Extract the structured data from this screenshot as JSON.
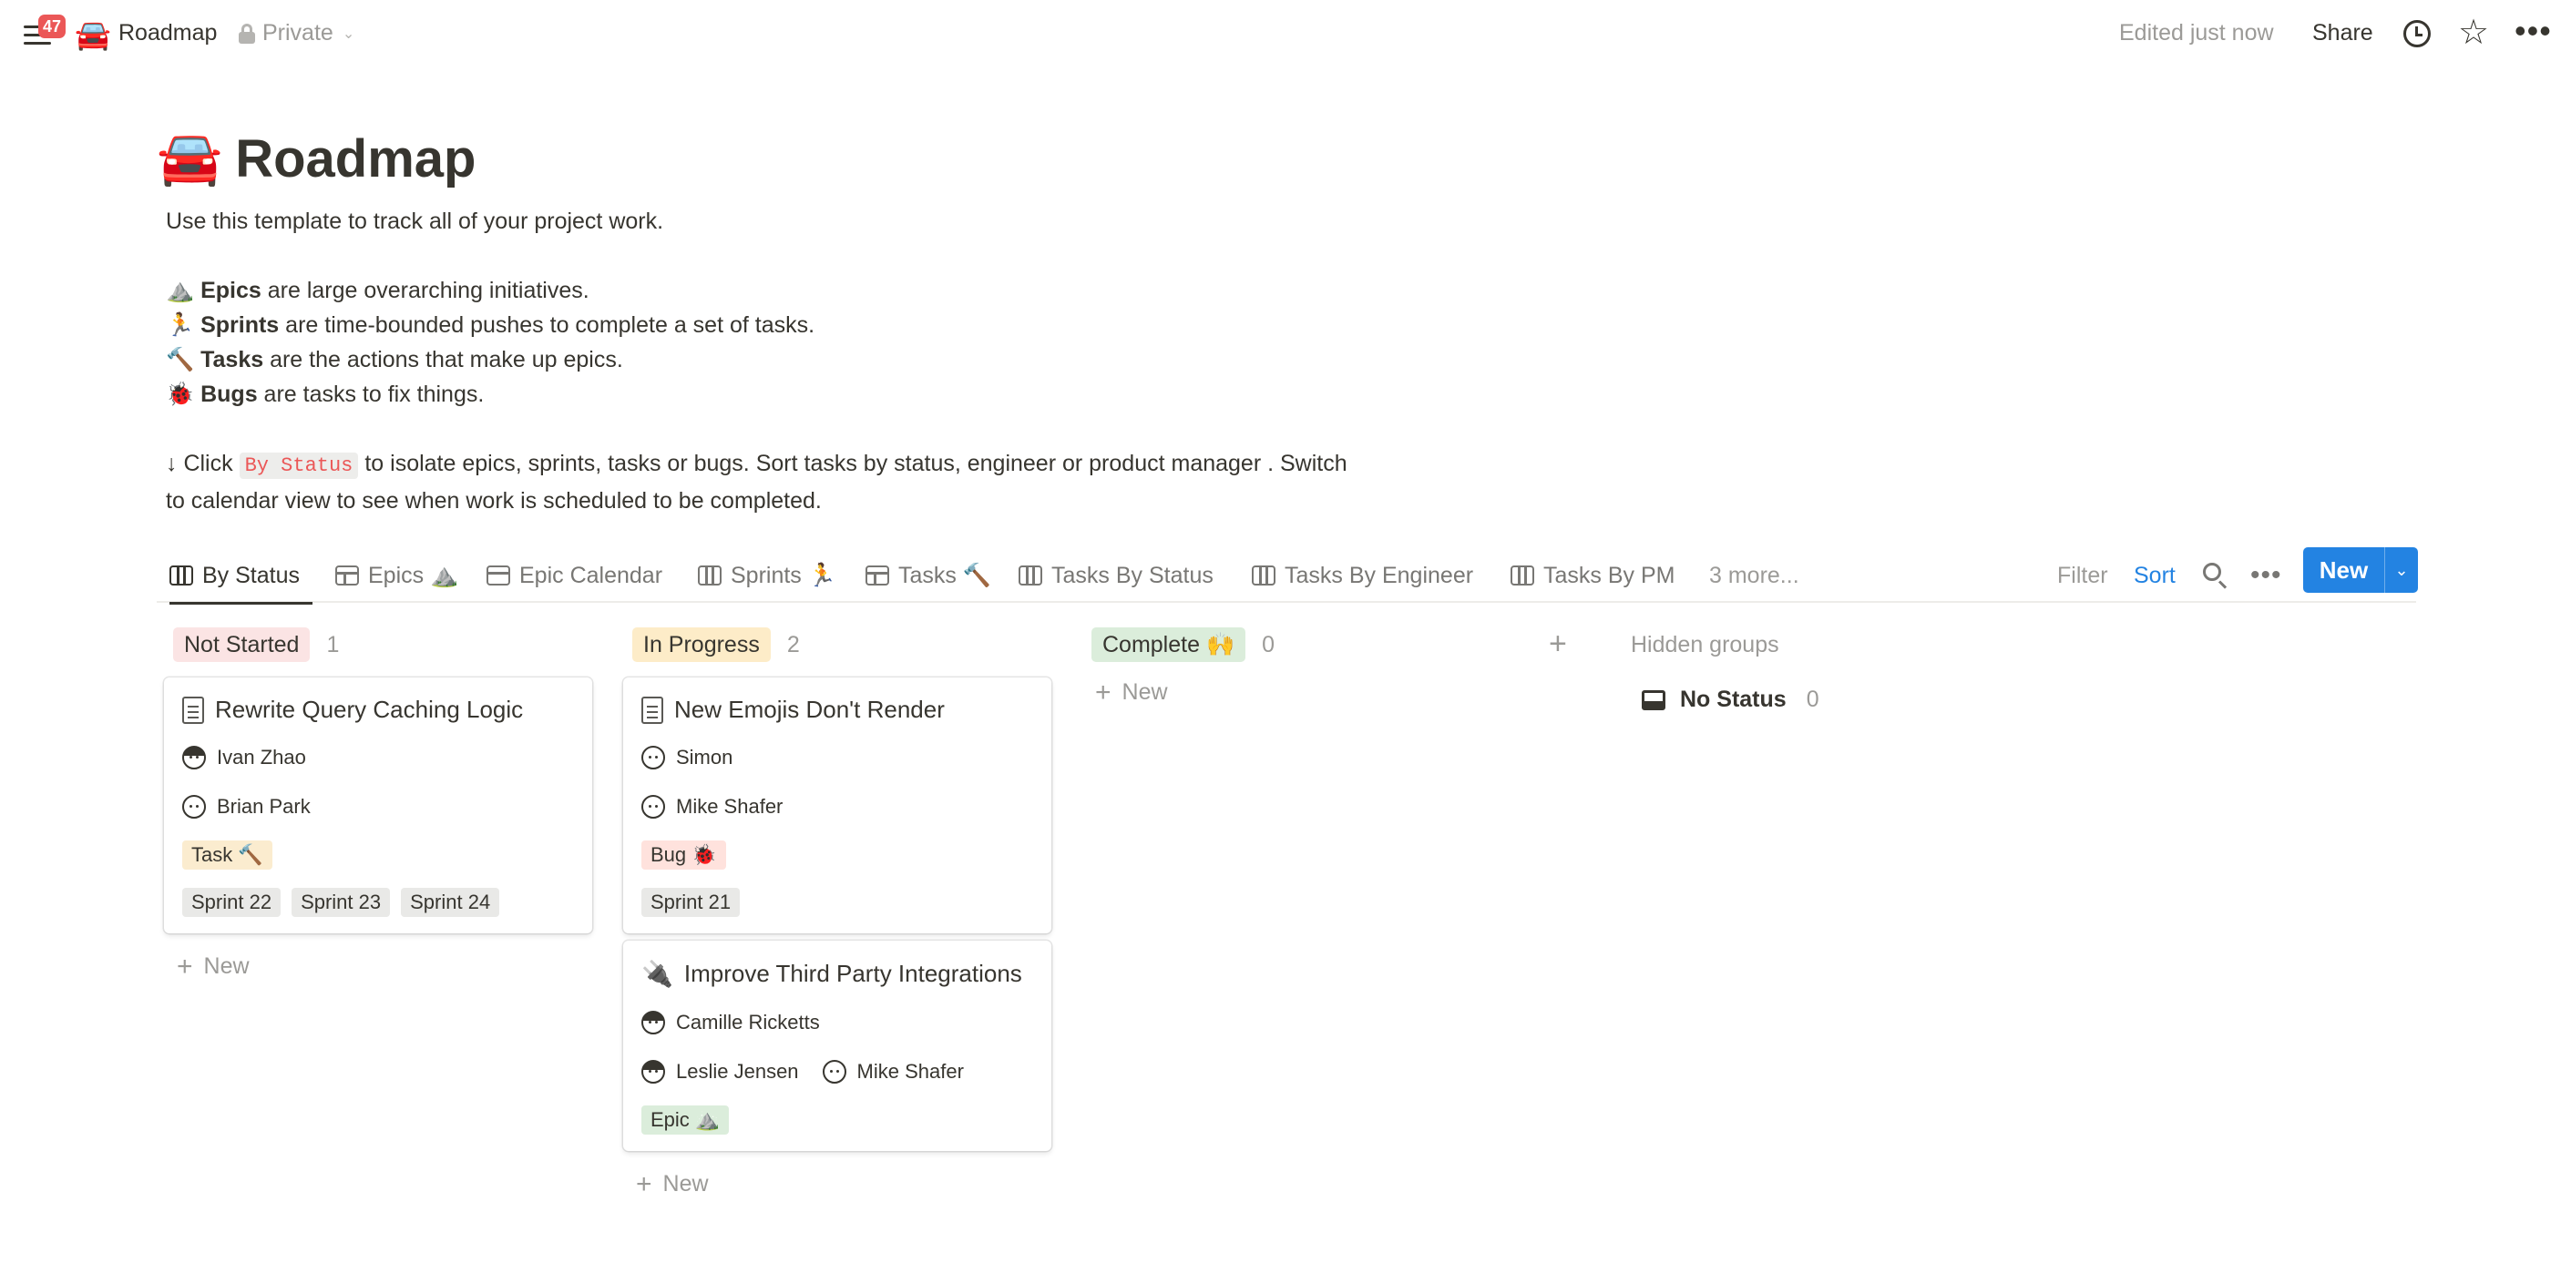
{
  "topbar": {
    "notification_count": "47",
    "page_icon": "🚘",
    "page_name": "Roadmap",
    "privacy": "Private",
    "edited": "Edited just now",
    "share_label": "Share",
    "icons": [
      "menu-icon",
      "lock-icon",
      "chevron-down-icon",
      "clock-icon",
      "star-icon",
      "more-icon"
    ]
  },
  "page": {
    "icon": "🚘",
    "title": "Roadmap",
    "intro": "Use this template to track all of your project work.",
    "lines": [
      {
        "emoji": "⛰️",
        "bold": "Epics",
        "text": " are large overarching initiatives."
      },
      {
        "emoji": "🏃",
        "bold": "Sprints",
        "text": " are time-bounded pushes to complete a set of tasks."
      },
      {
        "emoji": "🔨",
        "bold": "Tasks",
        "text": " are the actions that make up epics."
      },
      {
        "emoji": "🐞",
        "bold": "Bugs",
        "text": " are tasks to fix things."
      }
    ],
    "click_prefix": "↓ Click",
    "click_code": "By Status",
    "click_suffix": "to isolate epics, sprints, tasks or bugs. Sort tasks by status, engineer or product manager . Switch",
    "click_line2": "to calendar view to see when work is scheduled to be completed."
  },
  "views": {
    "tabs": [
      {
        "label": "By Status",
        "icon": "board-view-icon",
        "active": true
      },
      {
        "label": "Epics ⛰️",
        "icon": "table-view-icon",
        "active": false
      },
      {
        "label": "Epic Calendar",
        "icon": "calendar-view-icon",
        "active": false
      },
      {
        "label": "Sprints 🏃",
        "icon": "board-view-icon",
        "active": false
      },
      {
        "label": "Tasks 🔨",
        "icon": "table-view-icon",
        "active": false
      },
      {
        "label": "Tasks By Status",
        "icon": "board-view-icon",
        "active": false
      },
      {
        "label": "Tasks By Engineer",
        "icon": "board-view-icon",
        "active": false
      },
      {
        "label": "Tasks By PM",
        "icon": "board-view-icon",
        "active": false
      }
    ],
    "more": "3 more...",
    "filter": "Filter",
    "sort": "Sort",
    "new_label": "New",
    "accent_color": "#2383e2"
  },
  "board": {
    "columns": [
      {
        "status": "Not Started",
        "count": "1",
        "tag_bg": "#fbe4e4",
        "cards": [
          {
            "icon": "page",
            "title": "Rewrite Query Caching Logic",
            "people_rows": [
              [
                "Ivan Zhao"
              ],
              [
                "Brian Park"
              ]
            ],
            "type_tag": "Task 🔨",
            "type_bg": "#fbeccf",
            "sprints": [
              "Sprint 22",
              "Sprint 23",
              "Sprint 24"
            ]
          }
        ],
        "add_label": "New"
      },
      {
        "status": "In Progress",
        "count": "2",
        "tag_bg": "#fdecc8",
        "cards": [
          {
            "icon": "page",
            "title": "New Emojis Don't Render",
            "people_rows": [
              [
                "Simon"
              ],
              [
                "Mike Shafer"
              ]
            ],
            "type_tag": "Bug 🐞",
            "type_bg": "#ffe2dd",
            "sprints": [
              "Sprint 21"
            ]
          },
          {
            "icon": "🔌",
            "title": "Improve Third Party Integrations",
            "people_rows": [
              [
                "Camille Ricketts"
              ],
              [
                "Leslie Jensen",
                "Mike Shafer"
              ]
            ],
            "type_tag": "Epic ⛰️",
            "type_bg": "#dbeddb",
            "sprints": []
          }
        ],
        "add_label": "New"
      },
      {
        "status": "Complete 🙌",
        "count": "0",
        "tag_bg": "#dbeddb",
        "cards": [],
        "add_label": "New"
      }
    ],
    "hidden_groups_label": "Hidden groups",
    "no_status_label": "No Status",
    "no_status_count": "0",
    "sprint_bg": "#e9e9e7"
  }
}
